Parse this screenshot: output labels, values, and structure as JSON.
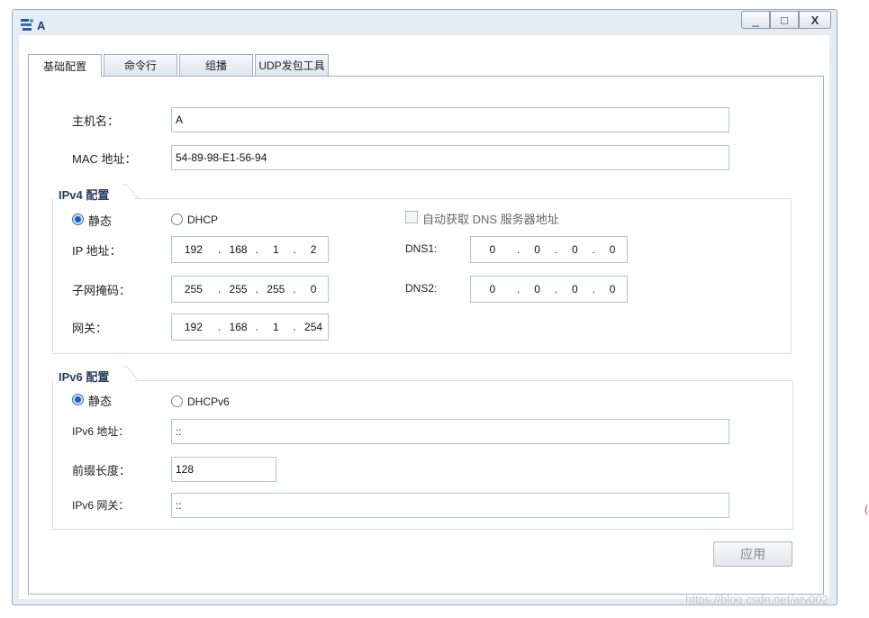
{
  "window": {
    "title": "A",
    "minimize": "_",
    "maximize": "□",
    "close": "X"
  },
  "tabs": [
    "基础配置",
    "命令行",
    "组播",
    "UDP发包工具"
  ],
  "basic": {
    "hostname_label": "主机名：",
    "hostname_value": "A",
    "mac_label": "MAC 地址：",
    "mac_value": "54-89-98-E1-56-94"
  },
  "ipv4": {
    "title": "IPv4 配置",
    "static_label": "静态",
    "dhcp_label": "DHCP",
    "auto_dns_label": "自动获取 DNS 服务器地址",
    "ip_label": "IP 地址：",
    "ip": [
      "192",
      "168",
      "1",
      "2"
    ],
    "mask_label": "子网掩码：",
    "mask": [
      "255",
      "255",
      "255",
      "0"
    ],
    "gateway_label": "网关：",
    "gateway": [
      "192",
      "168",
      "1",
      "254"
    ],
    "dns1_label": "DNS1:",
    "dns1": [
      "0",
      "0",
      "0",
      "0"
    ],
    "dns2_label": "DNS2:",
    "dns2": [
      "0",
      "0",
      "0",
      "0"
    ],
    "static_selected": true,
    "auto_dns_checked": false
  },
  "ipv6": {
    "title": "IPv6 配置",
    "static_label": "静态",
    "dhcp_label": "DHCPv6",
    "addr_label": "IPv6 地址：",
    "addr_value": "::",
    "prefix_label": "前缀长度：",
    "prefix_value": "128",
    "gateway_label": "IPv6 网关：",
    "gateway_value": "::",
    "static_selected": true
  },
  "apply_label": "应用",
  "watermark": "https://blog.csdn.net/aty002"
}
